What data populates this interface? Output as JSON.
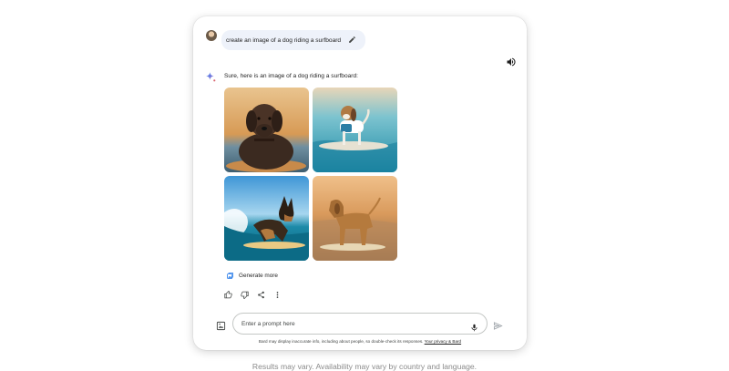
{
  "conversation": {
    "user_prompt": "create an image of a dog riding a surfboard",
    "response_text": "Sure, here is an image of a dog riding a surfboard:",
    "images": [
      {
        "icon": "labrador-on-surfboard-image"
      },
      {
        "icon": "beagle-on-paddleboard-image"
      },
      {
        "icon": "shepherd-surfing-wave-image"
      },
      {
        "icon": "hound-on-surfboard-sunset-image"
      }
    ],
    "generate_more_label": "Generate more"
  },
  "input": {
    "placeholder": "Enter a prompt here"
  },
  "disclaimer": {
    "text": "Bard may display inaccurate info, including about people, so double-check its responses.",
    "link": "Your privacy & Bard"
  },
  "footer": {
    "caption": "Results may vary. Availability may vary by country and language."
  },
  "colors": {
    "bubble": "#eef2fa",
    "accent_blue": "#4285f4",
    "sparkle_red": "#d96570"
  }
}
